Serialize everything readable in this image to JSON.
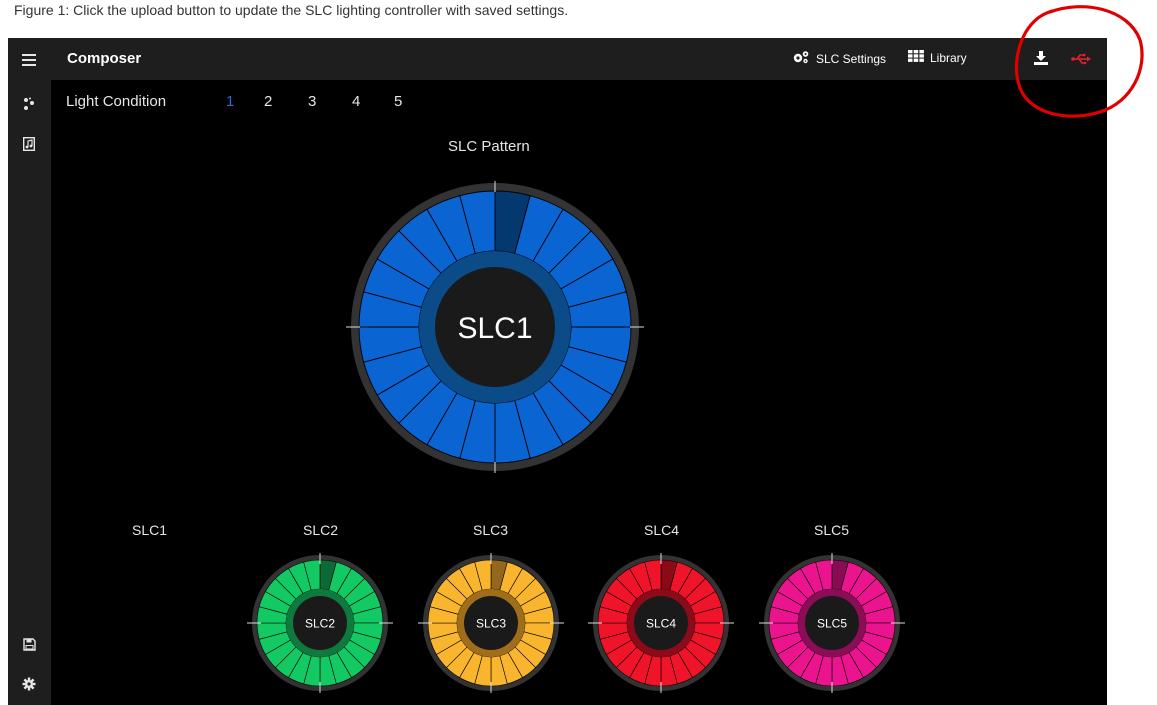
{
  "caption": "Figure 1: Click the upload button to update the SLC lighting controller with saved settings.",
  "app": {
    "title": "Composer"
  },
  "toolbar": {
    "settings_label": "SLC Settings",
    "settings_icon": "gears-icon",
    "library_label": "Library",
    "library_icon": "grid-icon",
    "download_icon": "download-icon",
    "usb_icon": "usb-icon"
  },
  "sidebar": {
    "top_items": [
      {
        "icon": "menu-icon"
      },
      {
        "icon": "sparkle-icon"
      },
      {
        "icon": "file-music-icon"
      }
    ],
    "bottom_items": [
      {
        "icon": "save-icon"
      },
      {
        "icon": "settings-icon"
      }
    ]
  },
  "light_condition": {
    "label": "Light Condition",
    "options": [
      "1",
      "2",
      "3",
      "4",
      "5"
    ],
    "selected": "1"
  },
  "pattern": {
    "title": "SLC Pattern",
    "center_label": "SLC1",
    "segments": 24
  },
  "slcs": [
    {
      "label": "SLC1",
      "center": "SLC1",
      "color": "#0a64d2",
      "dark": "#04396f",
      "ring": "#0b4b87"
    },
    {
      "label": "SLC2",
      "center": "SLC2",
      "color": "#13c964",
      "dark": "#0b6a35",
      "ring": "#0e7a3e"
    },
    {
      "label": "SLC3",
      "center": "SLC3",
      "color": "#fab52e",
      "dark": "#94671b",
      "ring": "#a06e1b"
    },
    {
      "label": "SLC4",
      "center": "SLC4",
      "color": "#f0142a",
      "dark": "#8a0a18",
      "ring": "#8c0b19"
    },
    {
      "label": "SLC5",
      "center": "SLC5",
      "color": "#ec138f",
      "dark": "#8a0b55",
      "ring": "#8b0d56"
    }
  ],
  "colors": {
    "ring_outer": "#333333",
    "hub": "#1a1a1a",
    "annotation": "#e00000",
    "active_tab": "#2a6fd0",
    "usb": "#e0212e"
  }
}
